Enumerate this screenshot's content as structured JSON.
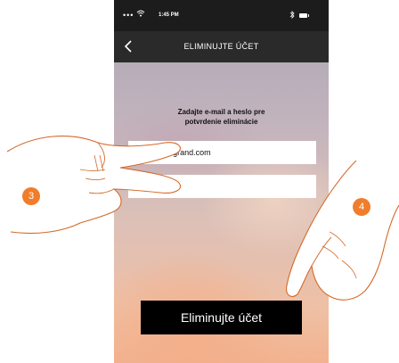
{
  "status_bar": {
    "signal": "•••",
    "time": "1:45 PM"
  },
  "header": {
    "title": "ELIMINUJTE ÚČET"
  },
  "form": {
    "instructions_line1": "Zadajte e-mail a heslo pre",
    "instructions_line2": "potvrdenie eliminácie",
    "email_value": "J.Smith@legrand.com",
    "password_value": "••••••••••"
  },
  "actions": {
    "delete_label": "Eliminujte účet"
  },
  "annotations": {
    "step_left": "3",
    "step_right": "4"
  },
  "icons": {
    "back": "chevron-left-icon",
    "wifi": "wifi-icon",
    "bluetooth": "bluetooth-icon",
    "battery": "battery-icon"
  },
  "colors": {
    "statusbar_bg": "#1c1c1c",
    "navbar_bg": "#2a2a2a",
    "button_bg": "#000000",
    "step_badge": "#f07d2b"
  }
}
